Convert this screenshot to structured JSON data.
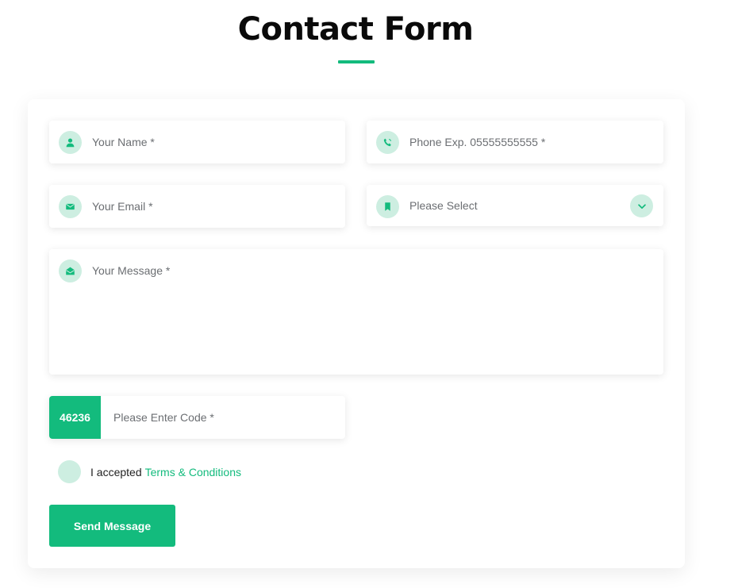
{
  "header": {
    "title": "Contact Form"
  },
  "form": {
    "name": {
      "placeholder": "Your Name *",
      "icon": "user-icon"
    },
    "phone": {
      "placeholder": "Phone Exp. 05555555555 *",
      "icon": "phone-icon"
    },
    "email": {
      "placeholder": "Your Email *",
      "icon": "envelope-icon"
    },
    "subject": {
      "selected": "Please Select",
      "icon": "bookmark-icon",
      "toggle_icon": "chevron-down-icon"
    },
    "message": {
      "placeholder": "Your Message *",
      "icon": "envelope-open-icon"
    },
    "captcha": {
      "code": "46236",
      "placeholder": "Please Enter Code *"
    },
    "terms": {
      "prefix": "I accepted",
      "link": "Terms & Conditions"
    },
    "submit_label": "Send Message"
  },
  "colors": {
    "accent": "#13bb7d",
    "icon_bg": "#cdeee1",
    "placeholder": "#6b6e72"
  }
}
